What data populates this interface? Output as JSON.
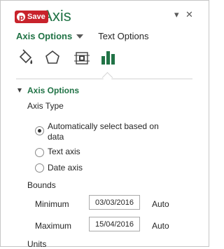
{
  "header": {
    "title": "at Axis",
    "pin_label": "Save",
    "menu_glyph": "▾",
    "close_glyph": "✕"
  },
  "tabs": {
    "active": "Axis Options",
    "inactive": "Text Options"
  },
  "icons": [
    "fill-line-icon",
    "effects-pentagon-icon",
    "size-properties-icon",
    "axis-options-bars-icon"
  ],
  "section": {
    "title": "Axis Options",
    "axis_type_label": "Axis Type",
    "radio_auto_line1": "Automatically select based on",
    "radio_auto_line2": "data",
    "radio_text": "Text axis",
    "radio_date": "Date axis",
    "selected": "auto",
    "bounds_label": "Bounds",
    "minimum_label": "Minimum",
    "minimum_value": "03/03/2016",
    "minimum_auto": "Auto",
    "maximum_label": "Maximum",
    "maximum_value": "15/04/2016",
    "maximum_auto": "Auto",
    "units_label": "Units"
  },
  "colors": {
    "accent": "#217346",
    "pin": "#c8232c"
  }
}
